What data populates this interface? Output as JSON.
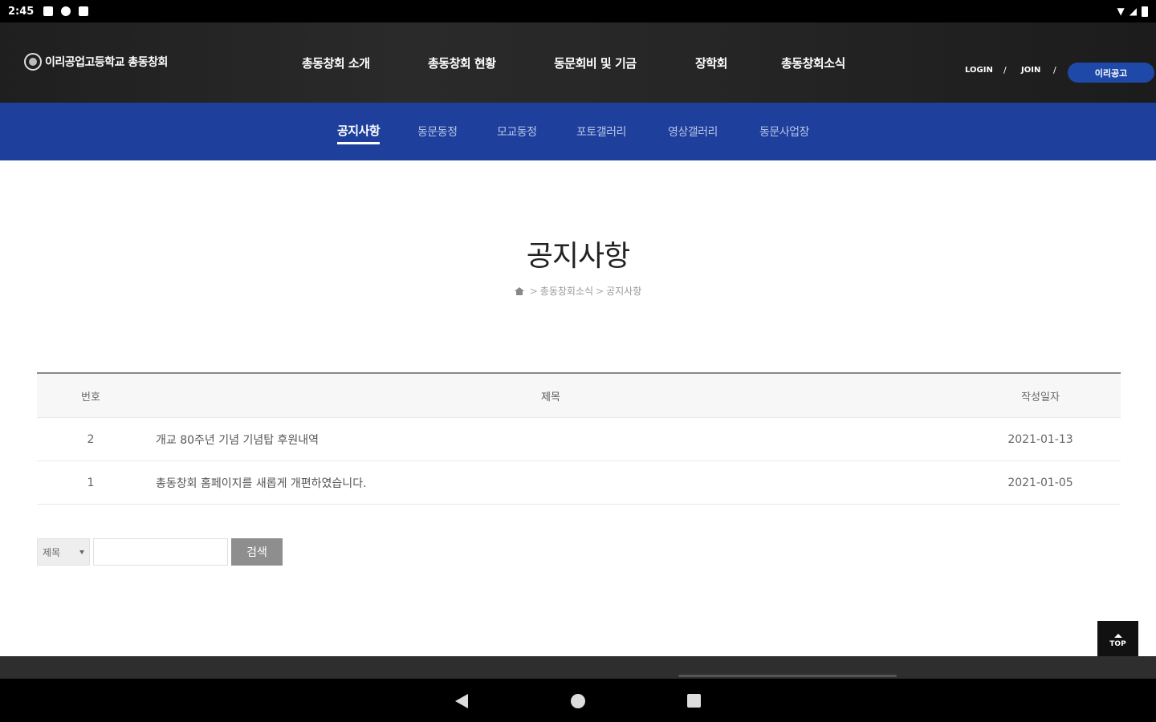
{
  "status_bar": {
    "time": "2:45"
  },
  "header": {
    "logo_text": "이리공업고등학교 총동창회",
    "nav": [
      {
        "label": "총동창회 소개"
      },
      {
        "label": "총동창회 현황"
      },
      {
        "label": "동문회비 및 기금"
      },
      {
        "label": "장학회"
      },
      {
        "label": "총동창회소식"
      }
    ],
    "util": {
      "login": "LOGIN",
      "join": "JOIN",
      "sep": "/",
      "iri_button": "이리공고"
    }
  },
  "subnav": {
    "items": [
      {
        "label": "공지사항",
        "active": true
      },
      {
        "label": "동문동정"
      },
      {
        "label": "모교동정"
      },
      {
        "label": "포토갤러리"
      },
      {
        "label": "영상갤러리"
      },
      {
        "label": "동문사업장"
      }
    ]
  },
  "page": {
    "title": "공지사항",
    "breadcrumb": [
      "총동창회소식",
      "공지사항"
    ],
    "breadcrumb_sep": ">"
  },
  "board": {
    "headers": {
      "no": "번호",
      "title": "제목",
      "date": "작성일자"
    },
    "rows": [
      {
        "no": "2",
        "title": "개교 80주년 기념 기념탑 후원내역",
        "date": "2021-01-13"
      },
      {
        "no": "1",
        "title": "총동창회 홈페이지를 새롭게 개편하였습니다.",
        "date": "2021-01-05"
      }
    ]
  },
  "search": {
    "field_selected": "제목",
    "keyword_value": "",
    "button_label": "검색"
  },
  "top_button": {
    "label": "TOP"
  },
  "colors": {
    "primary": "#1f3f9c",
    "button_blue": "#1f49a8",
    "header_bg": "#262626"
  }
}
